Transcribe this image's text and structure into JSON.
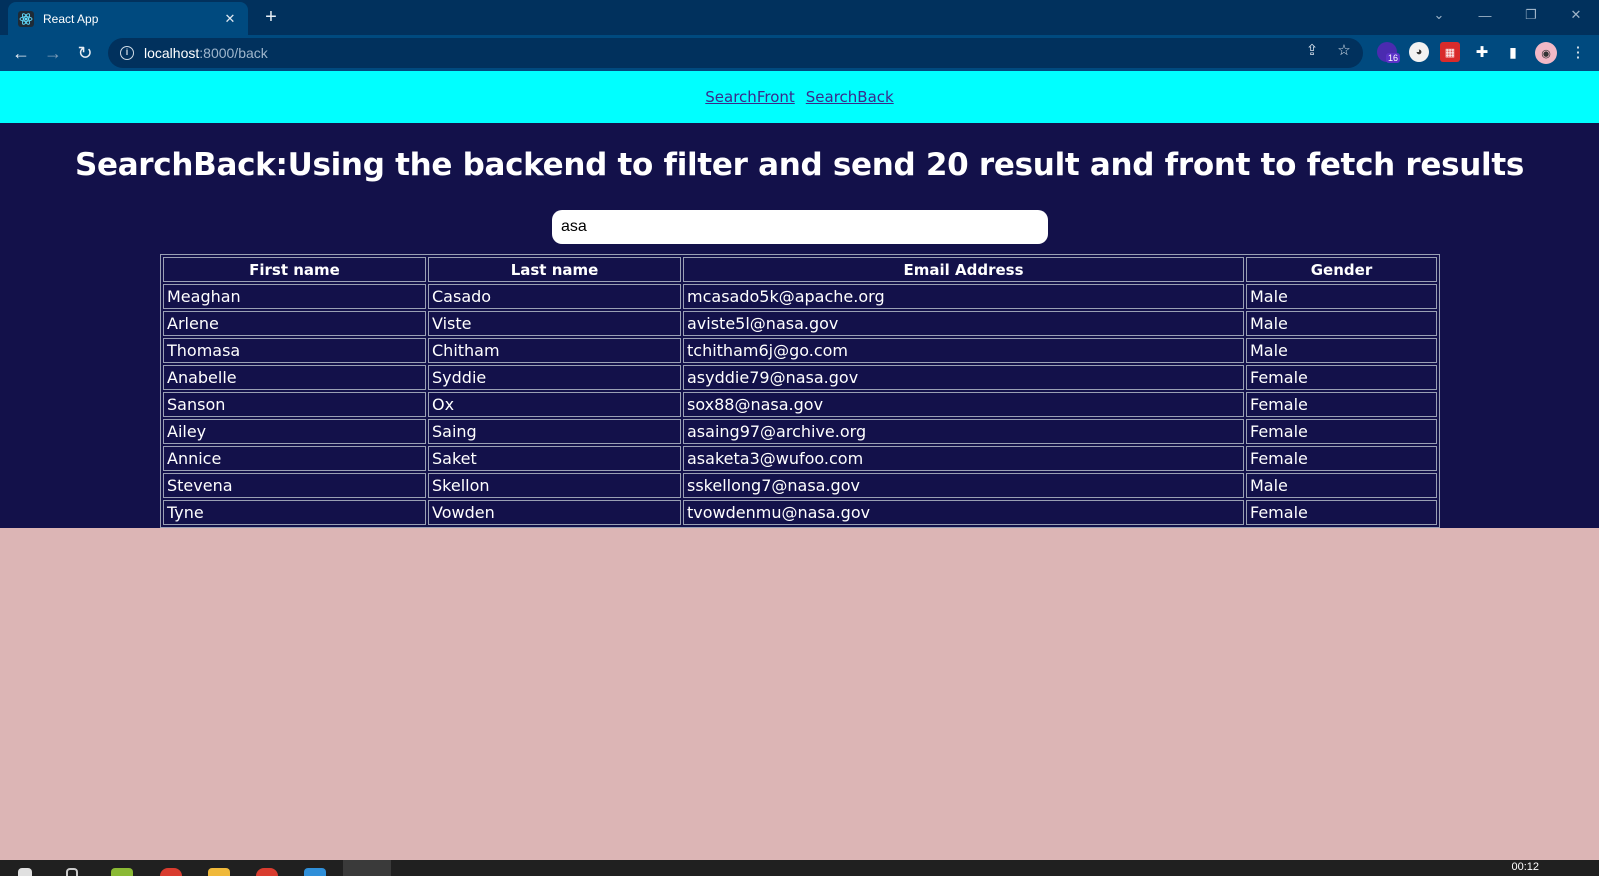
{
  "browser": {
    "tab_title": "React App",
    "tab_close": "✕",
    "new_tab": "+",
    "url_host": "localhost",
    "url_path": ":8000/back",
    "extension_badge": "16"
  },
  "nav": {
    "links": [
      "SearchFront",
      "SearchBack"
    ]
  },
  "page": {
    "heading": "SearchBack:Using the backend to filter and send 20 result and front to fetch results",
    "search_value": "asa"
  },
  "table": {
    "headers": [
      "First name",
      "Last name",
      "Email Address",
      "Gender"
    ],
    "rows": [
      [
        "Meaghan",
        "Casado",
        "mcasado5k@apache.org",
        "Male"
      ],
      [
        "Arlene",
        "Viste",
        "aviste5l@nasa.gov",
        "Male"
      ],
      [
        "Thomasa",
        "Chitham",
        "tchitham6j@go.com",
        "Male"
      ],
      [
        "Anabelle",
        "Syddie",
        "asyddie79@nasa.gov",
        "Female"
      ],
      [
        "Sanson",
        "Ox",
        "sox88@nasa.gov",
        "Female"
      ],
      [
        "Ailey",
        "Saing",
        "asaing97@archive.org",
        "Female"
      ],
      [
        "Annice",
        "Saket",
        "asaketa3@wufoo.com",
        "Female"
      ],
      [
        "Stevena",
        "Skellon",
        "sskellong7@nasa.gov",
        "Male"
      ],
      [
        "Tyne",
        "Vowden",
        "tvowdenmu@nasa.gov",
        "Female"
      ]
    ]
  },
  "taskbar": {
    "clock": "00:12"
  },
  "colors": {
    "nav_bg": "#00ffff",
    "main_bg": "#13114a",
    "body_bg": "#dcb5b5"
  }
}
